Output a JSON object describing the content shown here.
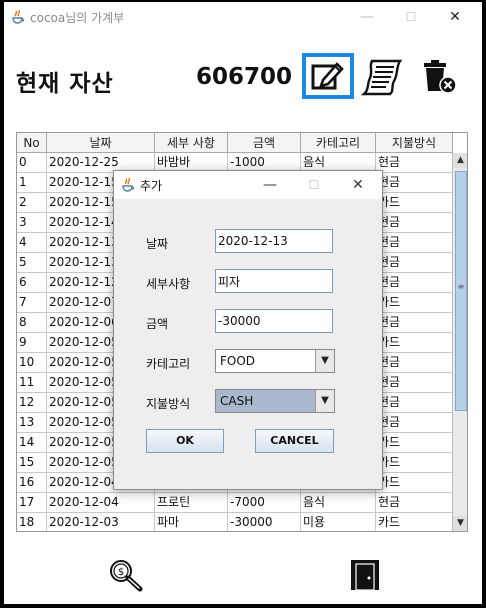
{
  "window": {
    "title": "cocoa님의 가계부",
    "min_glyph": "—",
    "max_glyph": "☐",
    "close_glyph": "✕"
  },
  "header": {
    "title": "현재 자산",
    "balance": "606700"
  },
  "toolbar_icons": [
    "edit-icon",
    "receipt-icon",
    "trash-delete-icon"
  ],
  "table": {
    "columns": [
      "No",
      "날짜",
      "세부 사항",
      "금액",
      "카테고리",
      "지불방식"
    ],
    "rows": [
      [
        "0",
        "2020-12-25",
        "바밤바",
        "-1000",
        "음식",
        "현금"
      ],
      [
        "1",
        "2020-12-15",
        "",
        "",
        "",
        "현금"
      ],
      [
        "2",
        "2020-12-15",
        "",
        "",
        "",
        "카드"
      ],
      [
        "3",
        "2020-12-14",
        "",
        "",
        "",
        "현금"
      ],
      [
        "4",
        "2020-12-13",
        "",
        "",
        "",
        "현금"
      ],
      [
        "5",
        "2020-12-13",
        "",
        "",
        "",
        "현금"
      ],
      [
        "6",
        "2020-12-12",
        "",
        "",
        "",
        "현금"
      ],
      [
        "7",
        "2020-12-07",
        "",
        "",
        "",
        "카드"
      ],
      [
        "8",
        "2020-12-06",
        "",
        "",
        "",
        "현금"
      ],
      [
        "9",
        "2020-12-05",
        "",
        "",
        "",
        "카드"
      ],
      [
        "10",
        "2020-12-05",
        "",
        "",
        "",
        "현금"
      ],
      [
        "11",
        "2020-12-05",
        "",
        "",
        "",
        "현금"
      ],
      [
        "12",
        "2020-12-05",
        "",
        "",
        "",
        "현금"
      ],
      [
        "13",
        "2020-12-05",
        "",
        "",
        "",
        "현금"
      ],
      [
        "14",
        "2020-12-05",
        "",
        "",
        "",
        "카드"
      ],
      [
        "15",
        "2020-12-05",
        "",
        "",
        "",
        "카드"
      ],
      [
        "16",
        "2020-12-04",
        "",
        "",
        "",
        "카드"
      ],
      [
        "17",
        "2020-12-04",
        "프로틴",
        "-7000",
        "음식",
        "현금"
      ],
      [
        "18",
        "2020-12-03",
        "파마",
        "-30000",
        "미용",
        "카드"
      ]
    ]
  },
  "dialog": {
    "title": "추가",
    "fields": {
      "date_label": "날짜",
      "date_value": "2020-12-13",
      "detail_label": "세부사항",
      "detail_value": "피자",
      "amount_label": "금액",
      "amount_value": "-30000",
      "category_label": "카테고리",
      "category_value": "FOOD",
      "payment_label": "지불방식",
      "payment_value": "CASH"
    },
    "ok_label": "OK",
    "cancel_label": "CANCEL"
  },
  "bottom_icons": [
    "money-search-icon",
    "exit-door-icon"
  ],
  "colors": {
    "accent_border": "#1e88e5",
    "selected_combo": "#a9b8cc",
    "scroll_thumb": "#b7d0ea"
  }
}
